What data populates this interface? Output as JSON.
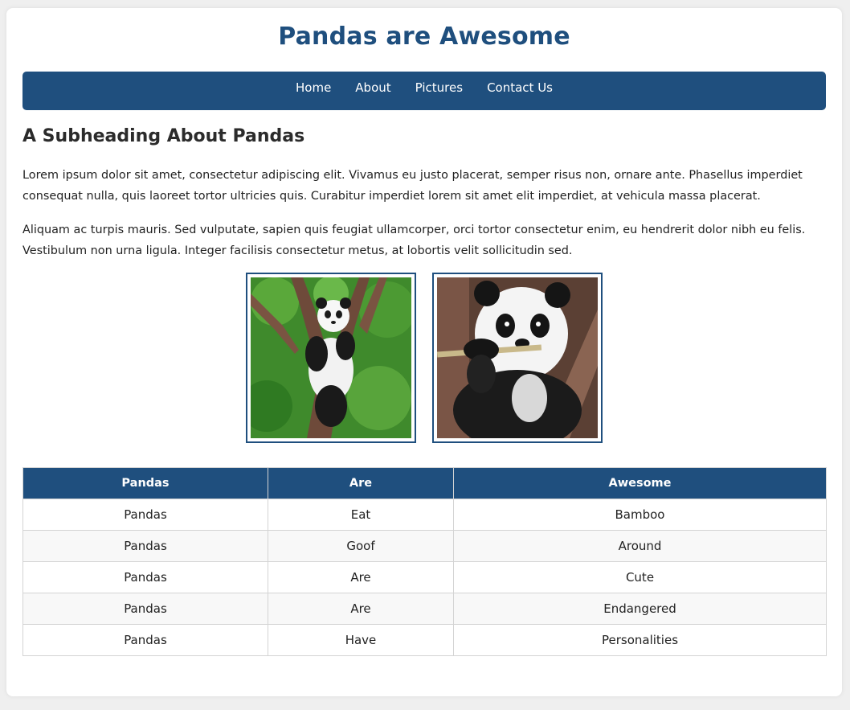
{
  "header": {
    "title": "Pandas are Awesome"
  },
  "nav": {
    "items": [
      {
        "label": "Home"
      },
      {
        "label": "About"
      },
      {
        "label": "Pictures"
      },
      {
        "label": "Contact Us"
      }
    ]
  },
  "main": {
    "subheading": "A Subheading About Pandas",
    "paragraphs": [
      "Lorem ipsum dolor sit amet, consectetur adipiscing elit. Vivamus eu justo placerat, semper risus non, ornare ante. Phasellus imperdiet consequat nulla, quis laoreet tortor ultricies quis. Curabitur imperdiet lorem sit amet elit imperdiet, at vehicula massa placerat.",
      "Aliquam ac turpis mauris. Sed vulputate, sapien quis feugiat ullamcorper, orci tortor consectetur enim, eu hendrerit dolor nibh eu felis. Vestibulum non urna ligula. Integer facilisis consectetur metus, at lobortis velit sollicitudin sed."
    ]
  },
  "table": {
    "headers": [
      "Pandas",
      "Are",
      "Awesome"
    ],
    "rows": [
      [
        "Pandas",
        "Eat",
        "Bamboo"
      ],
      [
        "Pandas",
        "Goof",
        "Around"
      ],
      [
        "Pandas",
        "Are",
        "Cute"
      ],
      [
        "Pandas",
        "Are",
        "Endangered"
      ],
      [
        "Pandas",
        "Have",
        "Personalities"
      ]
    ]
  },
  "colors": {
    "brand": "#1f4f7e",
    "page_bg": "#efefef",
    "row_alt": "#f8f8f8"
  }
}
